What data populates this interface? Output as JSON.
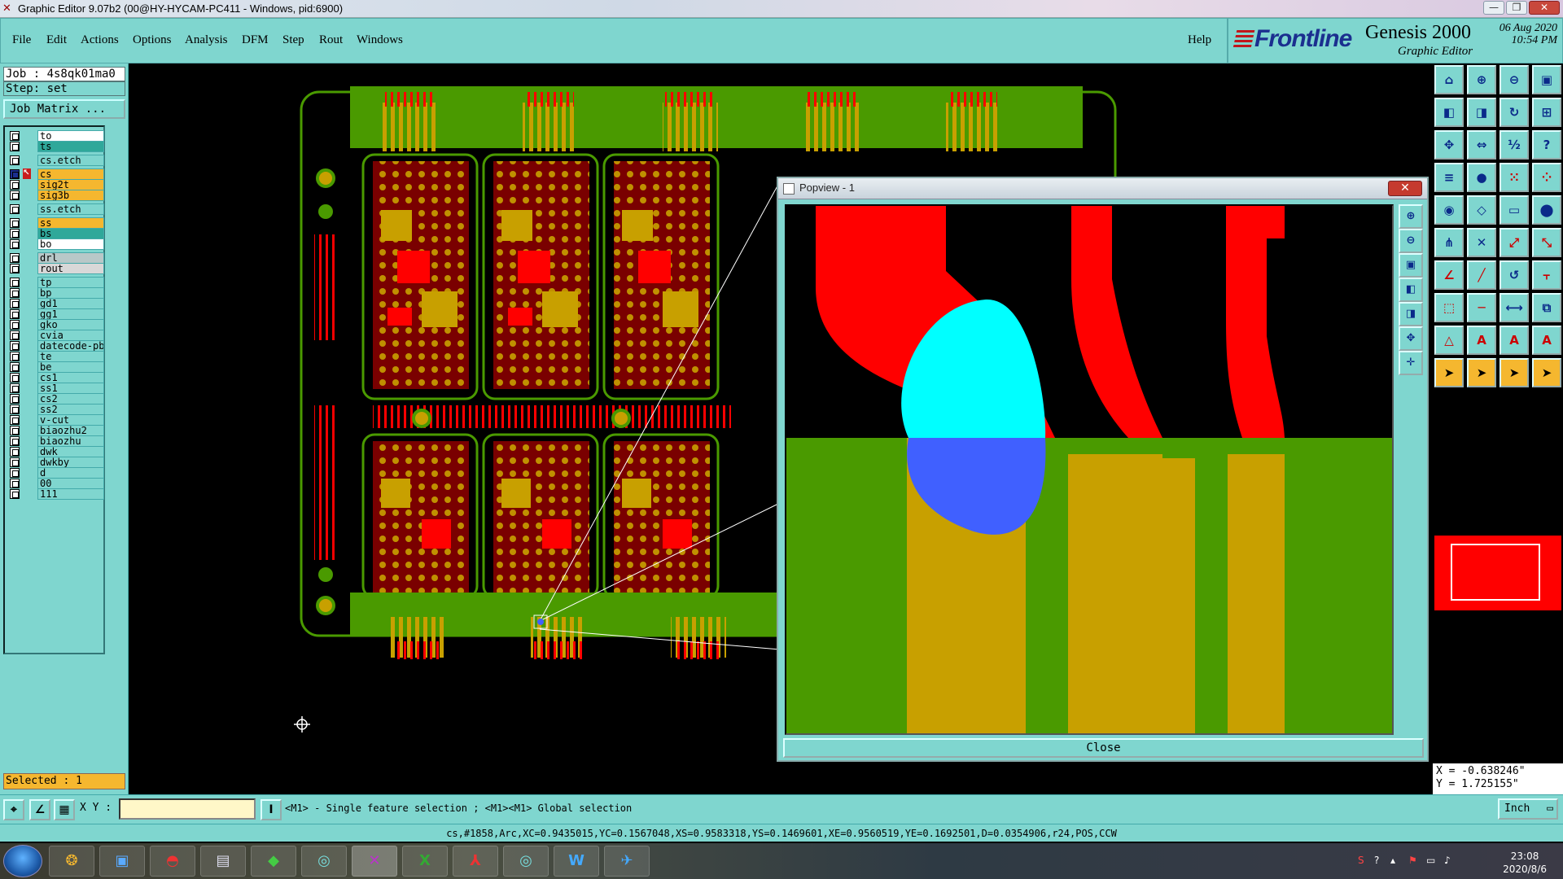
{
  "window": {
    "title": "Graphic Editor 9.07b2 (00@HY-HYCAM-PC411 - Windows, pid:6900)",
    "min_glyph": "—",
    "max_glyph": "❐",
    "close_glyph": "✕"
  },
  "menu": [
    {
      "label": "File",
      "name": "menu-file"
    },
    {
      "label": "Edit",
      "name": "menu-edit"
    },
    {
      "label": "Actions",
      "name": "menu-actions"
    },
    {
      "label": "Options",
      "name": "menu-options"
    },
    {
      "label": "Analysis",
      "name": "menu-analysis"
    },
    {
      "label": "DFM",
      "name": "menu-dfm"
    },
    {
      "label": "Step",
      "name": "menu-step"
    },
    {
      "label": "Rout",
      "name": "menu-rout"
    },
    {
      "label": "Windows",
      "name": "menu-windows"
    }
  ],
  "help_label": "Help",
  "brand": {
    "logo": "Frontline",
    "product": "Genesis 2000",
    "subtitle": "Graphic Editor",
    "date": "06 Aug 2020",
    "time": "10:54 PM"
  },
  "job": {
    "job_line": "Job : 4s8qk01ma0",
    "step_line": "Step: set",
    "matrix_button": "Job Matrix ..."
  },
  "layers": [
    {
      "name": "to",
      "bg": "#ffffff",
      "sw": "#7fd6cf"
    },
    {
      "name": "ts",
      "bg": "#2fa89a",
      "sw": "#7fd6cf"
    },
    {
      "name": "cs.etch",
      "bg": "#7fd6cf",
      "sw": "#7fd6cf"
    },
    {
      "name": "cs",
      "bg": "#f5b72f",
      "sw": "#c81e1e",
      "active": true
    },
    {
      "name": "sig2t",
      "bg": "#f5b72f",
      "sw": "#7fd6cf"
    },
    {
      "name": "sig3b",
      "bg": "#f5b72f",
      "sw": "#7fd6cf"
    },
    {
      "name": "ss.etch",
      "bg": "#7fd6cf",
      "sw": "#7fd6cf"
    },
    {
      "name": "ss",
      "bg": "#f5b72f",
      "sw": "#7fd6cf"
    },
    {
      "name": "bs",
      "bg": "#2fa89a",
      "sw": "#7fd6cf"
    },
    {
      "name": "bo",
      "bg": "#ffffff",
      "sw": "#7fd6cf"
    },
    {
      "name": "drl",
      "bg": "#b8c8c8",
      "sw": "#7fd6cf"
    },
    {
      "name": "rout",
      "bg": "#d8d8d8",
      "sw": "#7fd6cf"
    },
    {
      "name": "tp",
      "bg": "#7fd6cf",
      "sw": "#7fd6cf"
    },
    {
      "name": "bp",
      "bg": "#7fd6cf",
      "sw": "#7fd6cf"
    },
    {
      "name": "gd1",
      "bg": "#7fd6cf",
      "sw": "#7fd6cf"
    },
    {
      "name": "gg1",
      "bg": "#7fd6cf",
      "sw": "#7fd6cf"
    },
    {
      "name": "gko",
      "bg": "#7fd6cf",
      "sw": "#7fd6cf"
    },
    {
      "name": "cvia",
      "bg": "#7fd6cf",
      "sw": "#7fd6cf"
    },
    {
      "name": "datecode-pb",
      "bg": "#7fd6cf",
      "sw": "#7fd6cf"
    },
    {
      "name": "te",
      "bg": "#7fd6cf",
      "sw": "#7fd6cf"
    },
    {
      "name": "be",
      "bg": "#7fd6cf",
      "sw": "#7fd6cf"
    },
    {
      "name": "cs1",
      "bg": "#7fd6cf",
      "sw": "#7fd6cf"
    },
    {
      "name": "ss1",
      "bg": "#7fd6cf",
      "sw": "#7fd6cf"
    },
    {
      "name": "cs2",
      "bg": "#7fd6cf",
      "sw": "#7fd6cf"
    },
    {
      "name": "ss2",
      "bg": "#7fd6cf",
      "sw": "#7fd6cf"
    },
    {
      "name": "v-cut",
      "bg": "#7fd6cf",
      "sw": "#7fd6cf"
    },
    {
      "name": "biaozhu2",
      "bg": "#7fd6cf",
      "sw": "#7fd6cf"
    },
    {
      "name": "biaozhu",
      "bg": "#7fd6cf",
      "sw": "#7fd6cf"
    },
    {
      "name": "dwk",
      "bg": "#7fd6cf",
      "sw": "#7fd6cf"
    },
    {
      "name": "dwkby",
      "bg": "#7fd6cf",
      "sw": "#7fd6cf"
    },
    {
      "name": "d",
      "bg": "#7fd6cf",
      "sw": "#7fd6cf"
    },
    {
      "name": "00",
      "bg": "#7fd6cf",
      "sw": "#7fd6cf"
    },
    {
      "name": "111",
      "bg": "#7fd6cf",
      "sw": "#7fd6cf"
    }
  ],
  "selected": "Selected : 1",
  "popview": {
    "title": "Popview - 1",
    "close_x": "✕",
    "close_button": "Close"
  },
  "coords": {
    "x": "X = -0.638246\"",
    "y": "Y = 1.725155\""
  },
  "command": {
    "xy_label": "X Y :",
    "xy_value": "",
    "hint": "<M1> - Single feature selection ; <M1><M1> Global selection",
    "unit": "Inch"
  },
  "info_line": "cs,#1858,Arc,XC=0.9435015,YC=0.1567048,XS=0.9583318,YS=0.1469601,XE=0.9560519,YE=0.1692501,D=0.0354906,r24,POS,CCW",
  "taskbar": {
    "time": "23:08",
    "date": "2020/8/6"
  },
  "colors": {
    "panel": "#7fd6cf",
    "copper_red": "#ff0000",
    "pad_gold": "#c8a000",
    "board_green": "#4a9a00",
    "select_cyan": "#00ffff",
    "select_blue": "#4060ff"
  }
}
